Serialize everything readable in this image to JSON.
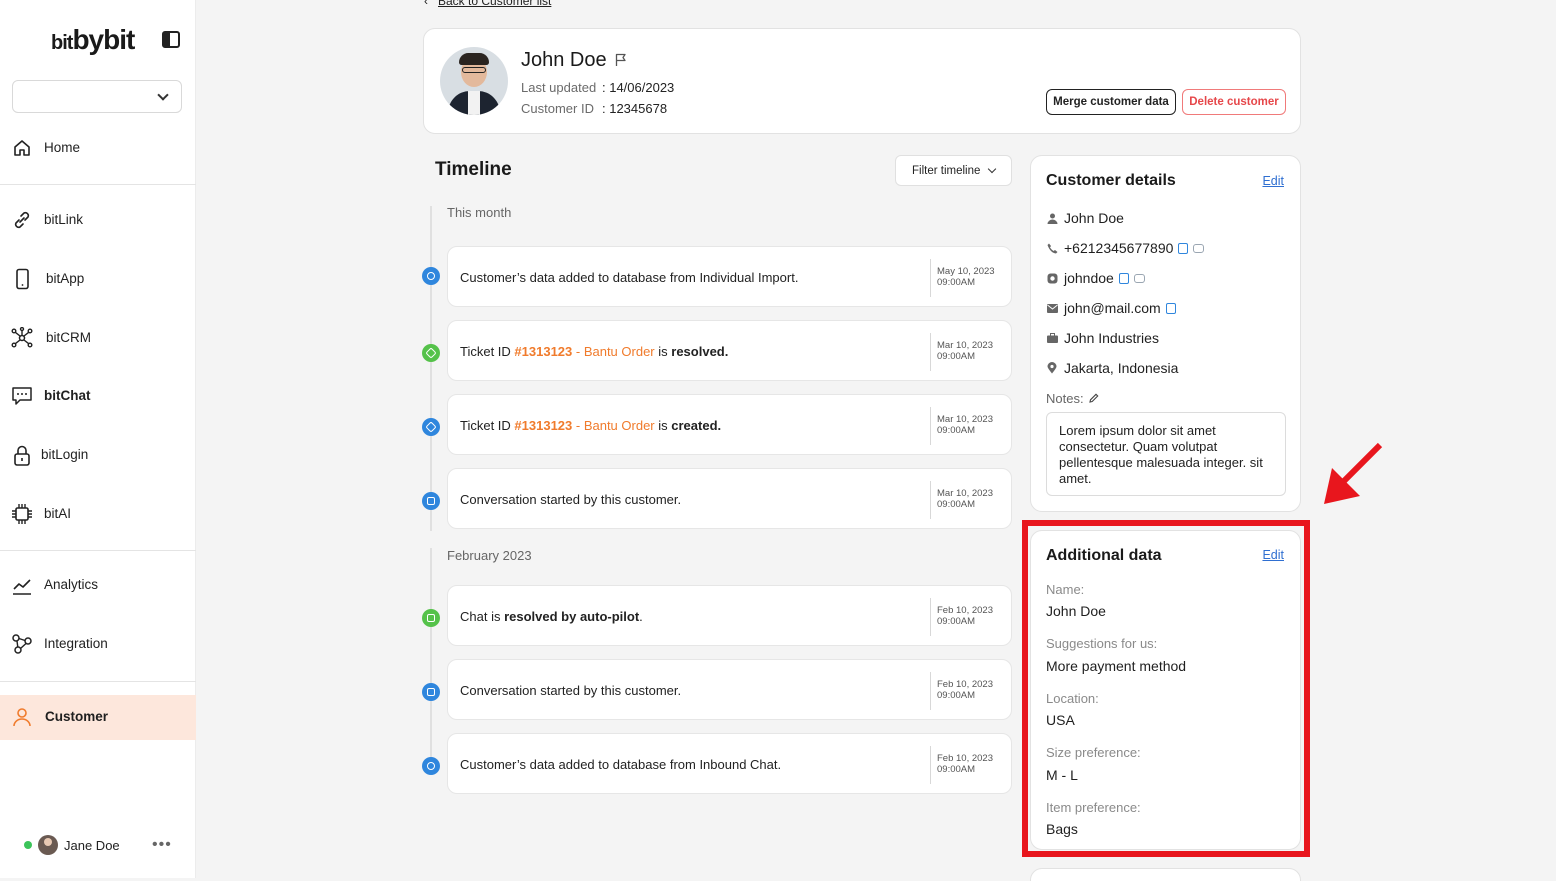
{
  "sidebar": {
    "logo": {
      "prefix": "bit",
      "main": "bybit"
    },
    "workspace_select": {
      "value": ""
    },
    "items": [
      {
        "label": "Home",
        "icon": "home-icon"
      },
      {
        "label": "bitLink",
        "icon": "link-icon"
      },
      {
        "label": "bitApp",
        "icon": "phone-icon"
      },
      {
        "label": "bitCRM",
        "icon": "network-icon"
      },
      {
        "label": "bitChat",
        "icon": "chat-icon"
      },
      {
        "label": "bitLogin",
        "icon": "lock-icon"
      },
      {
        "label": "bitAI",
        "icon": "chip-icon"
      },
      {
        "label": "Analytics",
        "icon": "analytics-icon"
      },
      {
        "label": "Integration",
        "icon": "integration-icon"
      },
      {
        "label": "Customer",
        "icon": "user-icon"
      }
    ],
    "user": {
      "name": "Jane Doe",
      "more": "•••"
    }
  },
  "back_link": "Back to Customer list",
  "customer": {
    "name": "John Doe",
    "last_updated_label": "Last updated",
    "last_updated_value": ": 14/06/2023",
    "id_label": "Customer ID",
    "id_value": ": 12345678",
    "merge_button": "Merge customer data",
    "delete_button": "Delete customer"
  },
  "timeline": {
    "title": "Timeline",
    "filter_label": "Filter timeline",
    "groups": [
      {
        "month": "This month"
      },
      {
        "month": "February 2023"
      }
    ],
    "events": [
      {
        "pre": "Customer’s data added to database from Individual Import.",
        "date": "May 10, 2023",
        "time": "09:00AM"
      },
      {
        "pre": "Ticket ID ",
        "ticket": "#1313123",
        "ticket_suffix": " - Bantu Order",
        "mid": " is ",
        "bold": "resolved.",
        "date": "Mar 10, 2023",
        "time": "09:00AM"
      },
      {
        "pre": "Ticket ID ",
        "ticket": "#1313123",
        "ticket_suffix": " - Bantu Order",
        "mid": " is ",
        "bold": "created.",
        "date": "Mar 10, 2023",
        "time": "09:00AM"
      },
      {
        "pre": "Conversation started by this customer.",
        "date": "Mar 10, 2023",
        "time": "09:00AM"
      },
      {
        "pre": "Chat is ",
        "bold": "resolved by auto-pilot",
        "post": ".",
        "date": "Feb 10, 2023",
        "time": "09:00AM"
      },
      {
        "pre": "Conversation started by this customer.",
        "date": "Feb 10, 2023",
        "time": "09:00AM"
      },
      {
        "pre": "Customer’s data added to database from Inbound Chat.",
        "date": "Feb 10, 2023",
        "time": "09:00AM"
      }
    ]
  },
  "customer_details": {
    "title": "Customer details",
    "edit": "Edit",
    "name": "John Doe",
    "phone": "+6212345677890",
    "instagram": "johndoe",
    "email": "john@mail.com",
    "company": "John Industries",
    "location": "Jakarta, Indonesia",
    "notes_label": "Notes:",
    "notes": "Lorem ipsum dolor sit amet consectetur. Quam volutpat pellentesque malesuada integer. sit amet."
  },
  "additional_data": {
    "title": "Additional data",
    "edit": "Edit",
    "fields": [
      {
        "label": "Name:",
        "value": "John Doe"
      },
      {
        "label": "Suggestions for us:",
        "value": "More payment method"
      },
      {
        "label": "Location:",
        "value": "USA"
      },
      {
        "label": "Size preference:",
        "value": "M - L"
      },
      {
        "label": "Item preference:",
        "value": "Bags"
      }
    ]
  },
  "colors": {
    "accent_orange": "#f07b2c",
    "active_nav_bg": "#fde7dc",
    "highlight_red": "#e8161d",
    "link_blue": "#2f6fd1",
    "timeline_blue": "#2f86dd",
    "timeline_green": "#55c24a"
  }
}
